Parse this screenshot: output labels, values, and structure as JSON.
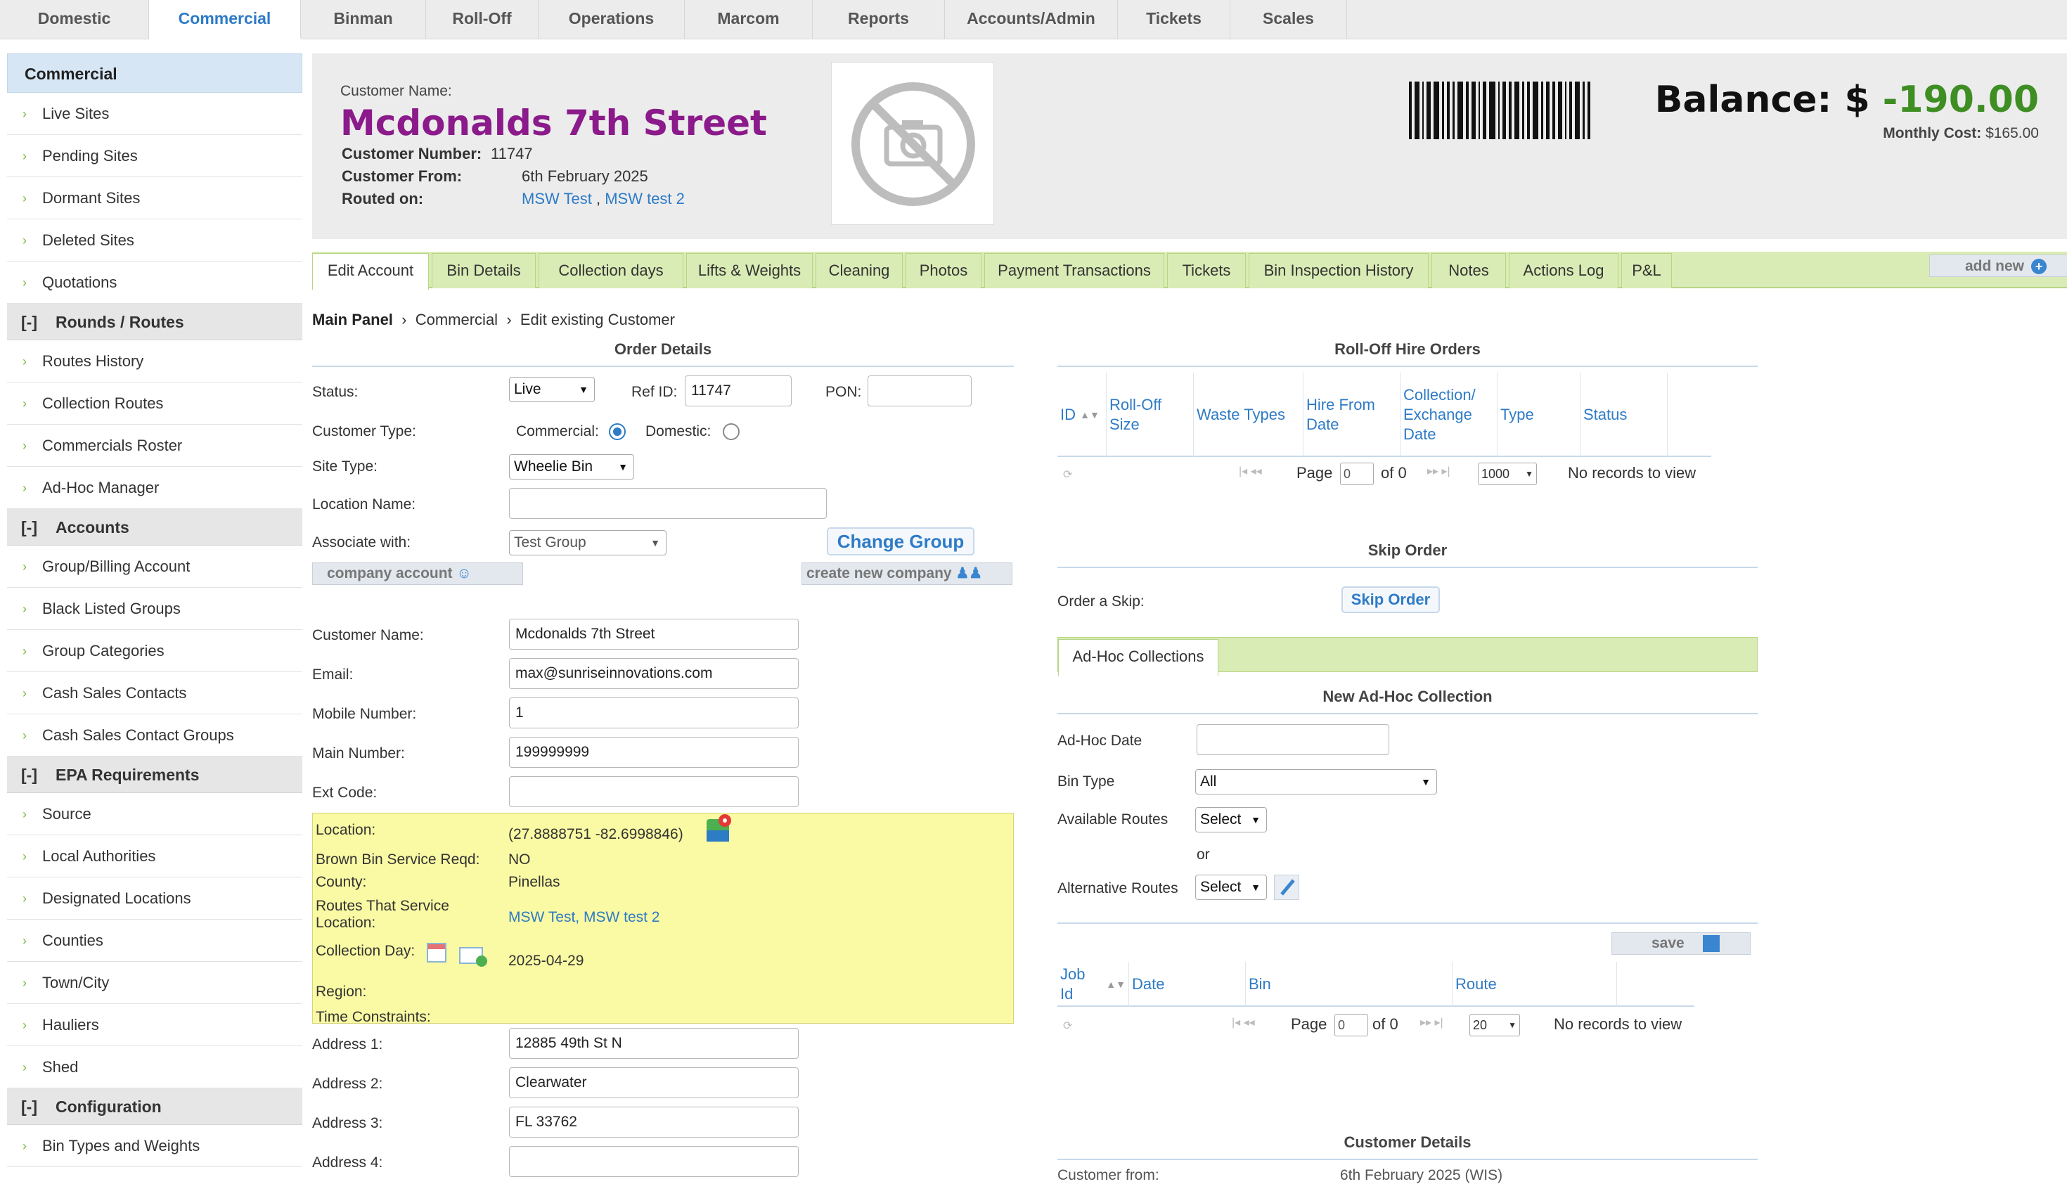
{
  "topnav": [
    "Domestic",
    "Commercial",
    "Binman",
    "Roll-Off",
    "Operations",
    "Marcom",
    "Reports",
    "Accounts/Admin",
    "Tickets",
    "Scales"
  ],
  "sidebar": {
    "head": "Commercial",
    "items_a": [
      "Live Sites",
      "Pending Sites",
      "Dormant Sites",
      "Deleted Sites",
      "Quotations"
    ],
    "group_rounds": "Rounds / Routes",
    "items_b": [
      "Routes History",
      "Collection Routes",
      "Commercials Roster",
      "Ad-Hoc Manager"
    ],
    "group_accounts": "Accounts",
    "items_c": [
      "Group/Billing Account",
      "Black Listed Groups",
      "Group Categories",
      "Cash Sales Contacts",
      "Cash Sales Contact Groups"
    ],
    "group_epa": "EPA Requirements",
    "items_d": [
      "Source",
      "Local Authorities",
      "Designated Locations",
      "Counties",
      "Town/City",
      "Hauliers",
      "Shed"
    ],
    "group_config": "Configuration",
    "items_e": [
      "Bin Types and Weights"
    ],
    "toggle": "[-]"
  },
  "header": {
    "customer_label": "Customer Name:",
    "customer_name": "Mcdonalds 7th Street",
    "number_label": "Customer Number:",
    "number": "11747",
    "from_label": "Customer From:",
    "from": "6th February 2025",
    "routed_label": "Routed on:",
    "route1": "MSW Test",
    "route_sep": ",",
    "route2": "MSW test 2",
    "balance_label": "Balance: $",
    "balance": "-190.00",
    "monthly_label": "Monthly Cost:",
    "monthly": "$165.00"
  },
  "tabs": [
    "Edit Account",
    "Bin Details",
    "Collection days",
    "Lifts & Weights",
    "Cleaning",
    "Photos",
    "Payment Transactions",
    "Tickets",
    "Bin Inspection History",
    "Notes",
    "Actions Log",
    "P&L"
  ],
  "add_new": "add new",
  "breadcrumb": {
    "root": "Main Panel",
    "sep": "›",
    "mid": "Commercial",
    "current": "Edit existing Customer"
  },
  "order": {
    "title": "Order Details",
    "status_label": "Status:",
    "status": "Live",
    "ref_label": "Ref ID:",
    "ref": "11747",
    "pon_label": "PON:",
    "pon": "",
    "ctype_label": "Customer Type:",
    "commercial": "Commercial:",
    "domestic": "Domestic:",
    "site_label": "Site Type:",
    "site": "Wheelie Bin",
    "locname_label": "Location Name:",
    "locname": "",
    "assoc_label": "Associate with:",
    "assoc": "Test Group",
    "change_group": "Change Group",
    "company_account": "company account",
    "create_company": "create new company",
    "cname_label": "Customer Name:",
    "cname": "Mcdonalds 7th Street",
    "email_label": "Email:",
    "email": "max@sunriseinnovations.com",
    "mobile_label": "Mobile Number:",
    "mobile": "1",
    "main_label": "Main Number:",
    "main": "199999999",
    "ext_label": "Ext Code:",
    "ext": "",
    "addr1_label": "Address 1:",
    "addr1": "12885 49th St N",
    "addr2_label": "Address 2:",
    "addr2": "Clearwater",
    "addr3_label": "Address 3:",
    "addr3": "FL 33762",
    "addr4_label": "Address 4:",
    "addr4": ""
  },
  "location": {
    "loc_label": "Location:",
    "loc": "(27.8888751 -82.6998846)",
    "brown_label": "Brown Bin Service Reqd:",
    "brown": "NO",
    "county_label": "County:",
    "county": "Pinellas",
    "routes_label1": "Routes That Service",
    "routes_label2": "Location:",
    "routes": "MSW Test, MSW test 2",
    "day_label": "Collection Day:",
    "day": "2025-04-29",
    "region_label": "Region:",
    "time_label": "Time Constraints:"
  },
  "rolloff": {
    "title": "Roll-Off Hire Orders",
    "cols": [
      "ID",
      "Roll-Off Size",
      "Waste Types",
      "Hire From Date",
      "Collection/ Exchange Date",
      "Type",
      "Status"
    ],
    "page_label": "Page",
    "page": "0",
    "of": "of 0",
    "per_page": "1000",
    "empty": "No records to view"
  },
  "skip": {
    "title": "Skip Order",
    "label": "Order a Skip:",
    "button": "Skip Order"
  },
  "adhoc": {
    "tab": "Ad-Hoc Collections",
    "title": "New Ad-Hoc Collection",
    "date_label": "Ad-Hoc Date",
    "date": "",
    "bin_label": "Bin Type",
    "bin": "All",
    "avail_label": "Available Routes",
    "avail": "Select",
    "or": "or",
    "alt_label": "Alternative Routes",
    "alt": "Select",
    "save": "save",
    "cols": [
      "Job Id",
      "Date",
      "Bin",
      "Route"
    ],
    "page_label": "Page",
    "page": "0",
    "of": "of 0",
    "per_page": "20",
    "empty": "No records to view"
  },
  "customer_details": {
    "title": "Customer Details",
    "row_label": "Customer from:",
    "row_value": "6th February 2025 (WIS)"
  }
}
